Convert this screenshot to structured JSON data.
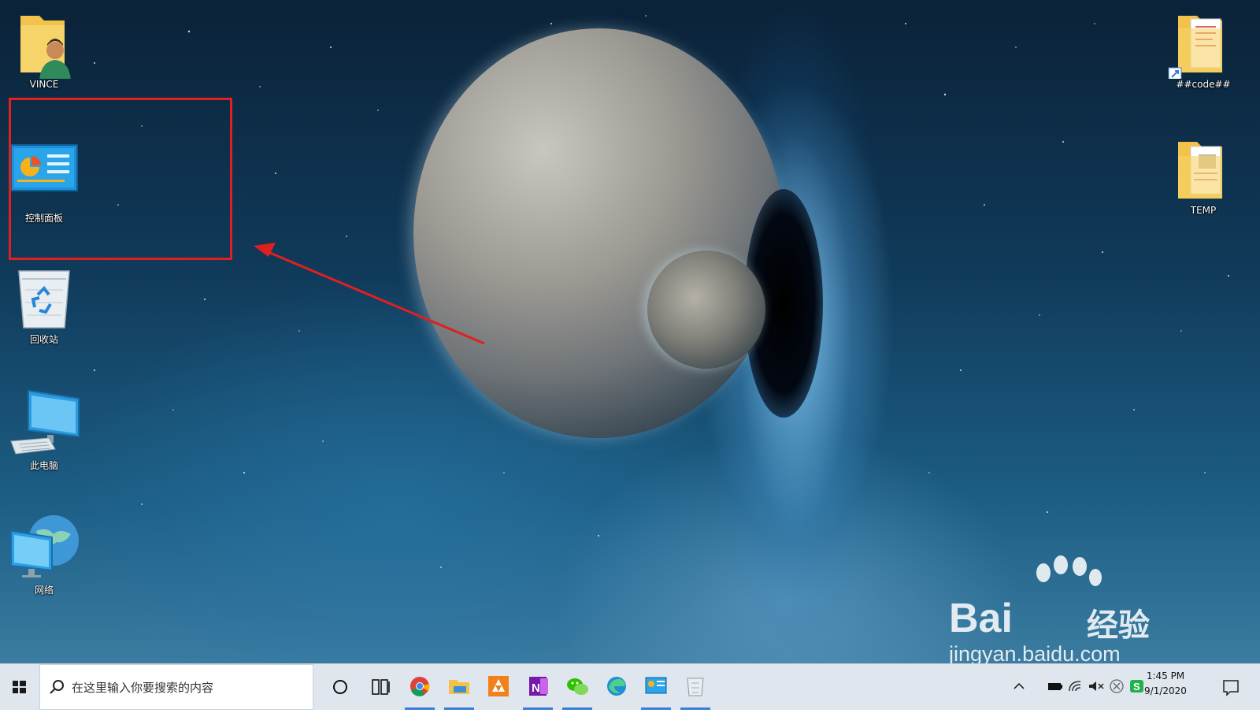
{
  "desktop": {
    "icons_left": [
      {
        "label": "VINCE",
        "icon": "user-folder-icon"
      },
      {
        "label": "控制面板",
        "icon": "control-panel-icon"
      },
      {
        "label": "回收站",
        "icon": "recycle-bin-icon"
      },
      {
        "label": "此电脑",
        "icon": "computer-icon"
      },
      {
        "label": "网络",
        "icon": "network-icon"
      }
    ],
    "icons_right": [
      {
        "label": "##code##",
        "icon": "shortcut-folder-icon"
      },
      {
        "label": "TEMP",
        "icon": "folder-icon"
      }
    ],
    "annotation": {
      "box_color": "#e02020",
      "arrow_color": "#e02020"
    }
  },
  "watermark": {
    "brand": "Bai",
    "product": "经验",
    "url": "jingyan.baidu.com"
  },
  "taskbar": {
    "start_icon": "windows-start-icon",
    "search_placeholder": "在这里输入你要搜索的内容",
    "buttons": [
      "cortana-circle-icon",
      "task-view-icon"
    ],
    "apps": [
      {
        "name": "chrome-icon",
        "active": true
      },
      {
        "name": "file-explorer-icon",
        "active": true
      },
      {
        "name": "orange-app-icon",
        "active": false
      },
      {
        "name": "onenote-icon",
        "active": true
      },
      {
        "name": "wechat-icon",
        "active": true
      },
      {
        "name": "edge-icon",
        "active": false
      },
      {
        "name": "control-panel-taskbar-icon",
        "active": true
      },
      {
        "name": "recycle-taskbar-icon",
        "active": true
      }
    ],
    "tray": [
      "chevron-up-icon",
      "battery-icon",
      "wifi-icon",
      "volume-muted-icon",
      "close-circle-icon",
      "green-s-icon"
    ],
    "time": "1:45 PM",
    "date": "9/1/2020",
    "notification_icon": "notification-icon"
  }
}
